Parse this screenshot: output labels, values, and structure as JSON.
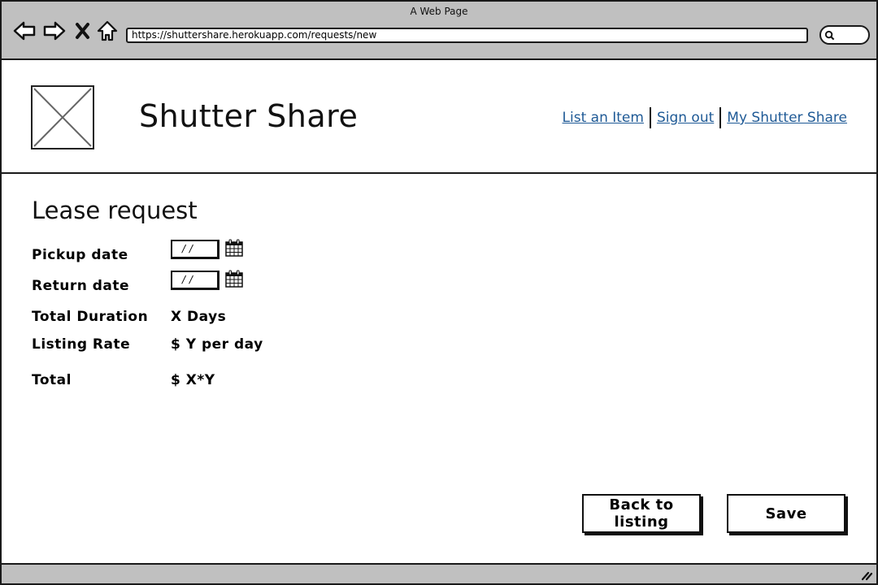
{
  "browser": {
    "window_title": "A Web Page",
    "url": "https://shuttershare.herokuapp.com/requests/new",
    "nav_icons": [
      "back-arrow-icon",
      "forward-arrow-icon",
      "stop-x-icon",
      "home-icon"
    ],
    "search_icon": "search-icon"
  },
  "header": {
    "logo_icon": "image-placeholder-icon",
    "brand": "Shutter Share",
    "links": [
      {
        "label": "List an Item"
      },
      {
        "label": "Sign out"
      },
      {
        "label": "My Shutter Share"
      }
    ],
    "link_color": "#1f5a96"
  },
  "form": {
    "title": "Lease request",
    "pickup": {
      "label": "Pickup date",
      "placeholder": "/ /"
    },
    "return": {
      "label": "Return date",
      "placeholder": "/ /"
    },
    "duration": {
      "label": "Total Duration",
      "value": "X Days"
    },
    "rate": {
      "label": "Listing Rate",
      "value": "$ Y per day"
    },
    "total": {
      "label": "Total",
      "value": "$ X*Y"
    }
  },
  "actions": {
    "back_label": "Back to listing",
    "save_label": "Save"
  }
}
